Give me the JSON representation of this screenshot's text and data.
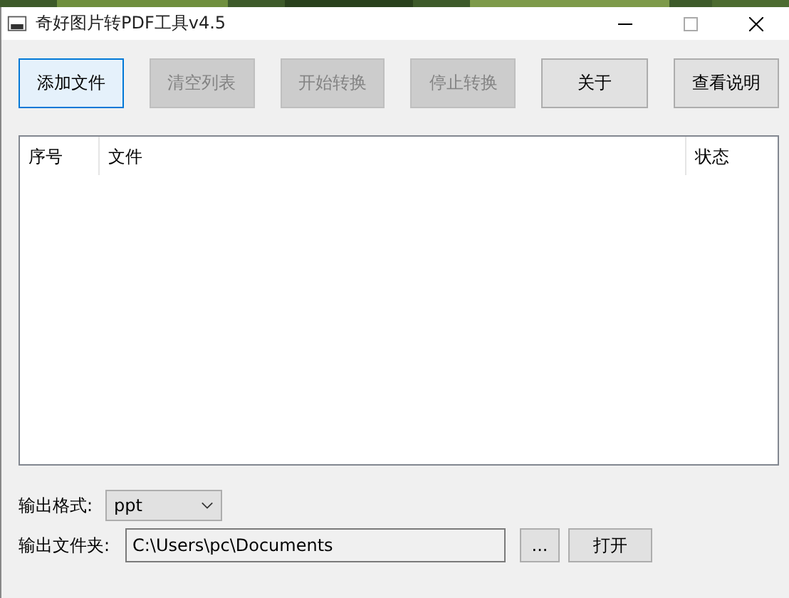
{
  "window": {
    "title": "奇好图片转PDF工具v4.5"
  },
  "buttons": [
    {
      "label": "添加文件",
      "disabled": false,
      "focused": true
    },
    {
      "label": "清空列表",
      "disabled": true,
      "focused": false
    },
    {
      "label": "开始转换",
      "disabled": true,
      "focused": false
    },
    {
      "label": "停止转换",
      "disabled": true,
      "focused": false
    },
    {
      "label": "关于",
      "disabled": false,
      "focused": false
    },
    {
      "label": "查看说明",
      "disabled": false,
      "focused": false
    }
  ],
  "table": {
    "columns": [
      "序号",
      "文件",
      "状态"
    ]
  },
  "output_format": {
    "label": "输出格式:",
    "value": "ppt"
  },
  "output_folder": {
    "label": "输出文件夹:",
    "value": "C:\\Users\\pc\\Documents",
    "browse_button": "...",
    "open_button": "打开"
  }
}
